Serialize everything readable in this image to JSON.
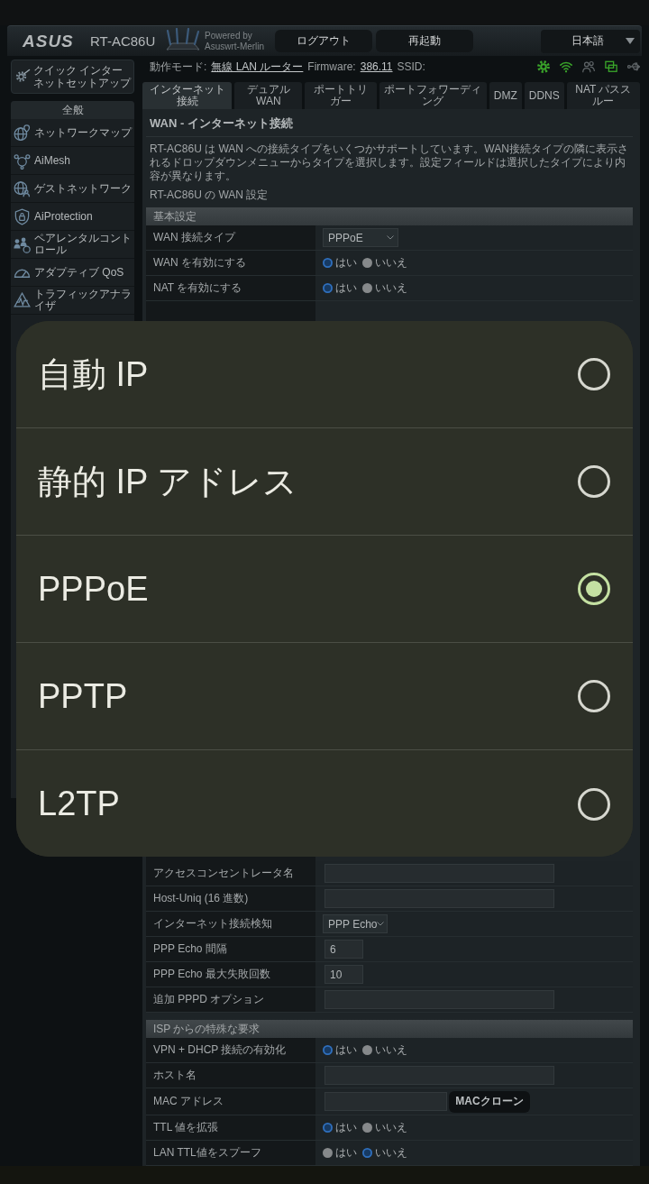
{
  "header": {
    "logo": "ASUS",
    "model": "RT-AC86U",
    "powered_by": "Powered by",
    "firmware_brand": "Asuswrt-Merlin",
    "buttons": [
      "ログアウト",
      "再起動"
    ],
    "language": "日本語"
  },
  "status_line": {
    "mode_label": "動作モード:",
    "mode": "無線 LAN ルーター",
    "firmware_label": "Firmware:",
    "firmware": "386.11",
    "ssid_label": "SSID:",
    "icons": [
      {
        "on": true
      },
      {
        "on": true
      },
      {
        "on": false
      },
      {
        "on": true
      },
      {
        "on": false
      }
    ]
  },
  "sidebar": {
    "quick_setup": "クイック インターネットセットアップ",
    "section": "全般",
    "items": [
      {
        "label": "ネットワークマップ",
        "selected": false
      },
      {
        "label": "AiMesh",
        "selected": false
      },
      {
        "label": "ゲストネットワーク",
        "selected": false
      },
      {
        "label": "AiProtection",
        "selected": false
      },
      {
        "label": "ペアレンタルコントロール",
        "selected": false
      },
      {
        "label": "アダプティブ QoS",
        "selected": false
      },
      {
        "label": "トラフィックアナライザ",
        "selected": false
      }
    ]
  },
  "tabs": [
    {
      "label": "インターネット接続",
      "selected": true
    },
    {
      "label": "デュアル WAN",
      "selected": false
    },
    {
      "label": "ポートトリガー",
      "selected": false
    },
    {
      "label": "ポートフォワーディング",
      "selected": false
    },
    {
      "label": "DMZ",
      "selected": false
    },
    {
      "label": "DDNS",
      "selected": false
    },
    {
      "label": "NAT パススルー",
      "selected": false
    }
  ],
  "panel": {
    "title": "WAN - インターネット接続",
    "description": "RT-AC86U は WAN への接続タイプをいくつかサポートしています。WAN接続タイプの隣に表示されるドロップダウンメニューからタイプを選択します。設定フィールドは選択したタイプにより内容が異なります。",
    "subtitle": "RT-AC86U の WAN 設定",
    "sections": [
      {
        "title": "基本設定",
        "rows": [
          {
            "kind": "select",
            "label": "WAN 接続タイプ",
            "value": "PPPoE"
          },
          {
            "kind": "radio",
            "label": "WAN を有効にする",
            "options": [
              {
                "label": "はい",
                "selected": true
              },
              {
                "label": "いいえ",
                "selected": false
              }
            ]
          },
          {
            "kind": "radio",
            "label": "NAT を有効にする",
            "options": [
              {
                "label": "はい",
                "selected": true
              },
              {
                "label": "いいえ",
                "selected": false
              }
            ]
          }
        ]
      },
      {
        "rows": [
          {
            "kind": "input",
            "label": "アクセスコンセントレータ名"
          },
          {
            "kind": "input",
            "label": "Host-Uniq (16 進数)"
          },
          {
            "kind": "select",
            "label": "インターネット接続検知",
            "value": "PPP Echo"
          },
          {
            "kind": "number",
            "label": "PPP Echo 間隔",
            "value": "6"
          },
          {
            "kind": "number",
            "label": "PPP Echo 最大失敗回数",
            "value": "10"
          },
          {
            "kind": "input",
            "label": "追加 PPPD オプション"
          }
        ]
      },
      {
        "title": "ISP からの特殊な要求",
        "rows": [
          {
            "kind": "radio",
            "label": "VPN + DHCP 接続の有効化",
            "options": [
              {
                "label": "はい",
                "selected": true
              },
              {
                "label": "いいえ",
                "selected": false
              }
            ]
          },
          {
            "kind": "input",
            "label": "ホスト名"
          },
          {
            "kind": "mac",
            "label": "MAC アドレス",
            "button": "MACクローン"
          },
          {
            "kind": "radio",
            "label": "TTL 値を拡張",
            "options": [
              {
                "label": "はい",
                "selected": true
              },
              {
                "label": "いいえ",
                "selected": false
              }
            ]
          },
          {
            "kind": "radio",
            "label": "LAN TTL値をスプーフ",
            "options": [
              {
                "label": "はい",
                "selected": false
              },
              {
                "label": "いいえ",
                "selected": true
              }
            ]
          }
        ]
      }
    ]
  },
  "dialog": {
    "options": [
      {
        "label": "自動 IP",
        "selected": false
      },
      {
        "label": "静的 IP アドレス",
        "selected": false
      },
      {
        "label": "PPPoE",
        "selected": true
      },
      {
        "label": "PPTP",
        "selected": false
      },
      {
        "label": "L2TP",
        "selected": false
      }
    ]
  }
}
